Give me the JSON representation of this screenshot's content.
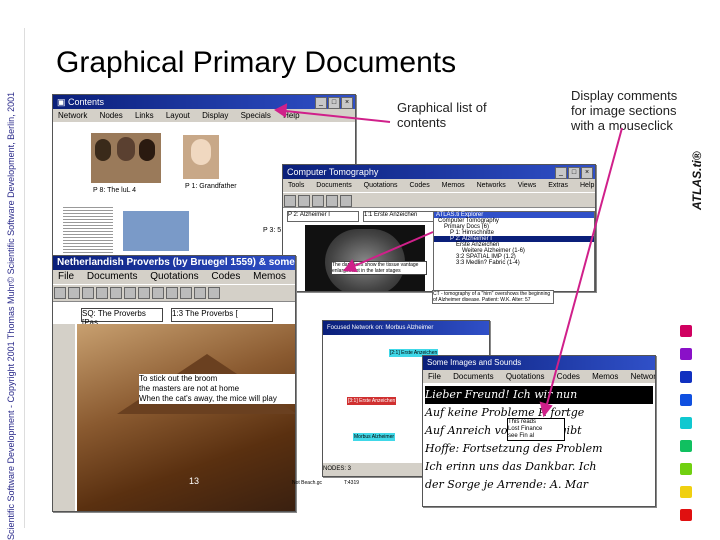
{
  "copyright_sidebar": "Scientific Software Development - Copyright 2001 Thomas Muhr© Scientific Software Development, Berlin, 2001",
  "brand": "ATLAS.ti®",
  "page_title": "Graphical Primary Documents",
  "callouts": {
    "list": "Graphical list of contents",
    "comments_l1": "Display comments",
    "comments_l2": "for image sections",
    "comments_l3": "with a mouseclick"
  },
  "contents_window": {
    "title": "Contents",
    "menu": [
      "Network",
      "Nodes",
      "Links",
      "Layout",
      "Display",
      "Specials",
      "Help"
    ],
    "thumb1_label": "P 8: The luL 4",
    "thumb2_label": "P 1: Grandfather",
    "thumb3_label": "P 3: 5"
  },
  "tomo_window": {
    "title": "Computer Tomography",
    "menu": [
      "Tools",
      "Documents",
      "Quotations",
      "Codes",
      "Memos",
      "Networks",
      "Views",
      "Extras",
      "Help"
    ],
    "field1": "P 2: Alzheimer I",
    "field2": "1:1 Erste Anzeichen",
    "note": "The dark lines show the tissue vantage enlargement in the later stages",
    "explorer_title": "ATLAS.ti Explorer",
    "tree": [
      "Computer Tomography",
      "Primary Docs (6)",
      "P 1: Hirnschnitte",
      "P 2: Alzheimer I",
      "Erste Anzeichen",
      "Weitere Alzheimer (1-6)",
      "3:2 SPATIAL IMP (1.2)",
      "3:3 Medlin? Fabric (1-4)"
    ],
    "comment": "CT - tomography of a \"hirn\" overshows the beginning of Alzheimer disease. Patient: W.K. Alter: 57"
  },
  "bruegel_window": {
    "title": "Netherlandish Proverbs (by Bruegel 1559) & some...",
    "menu": [
      "File",
      "Documents",
      "Quotations",
      "Codes",
      "Memos"
    ],
    "field1": "SQ: The Proverbs [Pas",
    "field2": "1:3 The Proverbs [",
    "caption1": "To stick out the broom",
    "caption2": "the masters are not at home",
    "caption3": "When the cat's away, the mice will play",
    "status": "13"
  },
  "network_window": {
    "title": "Focused Network on: Morbus Alzheimer",
    "node1": "[2:1] Erste Anzeichen",
    "node2": "[3:1] Erste Anzeichen",
    "node3": "Morbus Alzheimer",
    "status1": "NODES: 3",
    "status2": "Not Beach.gc",
    "status3": "T:4319"
  },
  "ger_window": {
    "title": "Some Images and Sounds",
    "menu": [
      "File",
      "Documents",
      "Quotations",
      "Codes",
      "Memos",
      "Networks"
    ],
    "popup1": "This reads",
    "popup2": "Lost Finance",
    "popup3": "see Fin al",
    "lines": [
      "Lieber Freund! Ich wir nun",
      "Auf keine Probleme P. fortge",
      "Auf Anreich vor die mir gibt",
      "Hoffe: Fortsetzung des Problem",
      "Ich erinn uns das Dankbar. Ich",
      "der Sorge je Arrende: A. Mar"
    ]
  },
  "colors": {
    "title_bar": "#0a1f7a",
    "arrow_magenta": "#d0208a",
    "nav_squares": [
      "#d00060",
      "#8a10c8",
      "#1030c0",
      "#1050e0",
      "#10c8d0",
      "#10c060",
      "#70d010",
      "#f0d010",
      "#f07010",
      "#e01010"
    ]
  },
  "icons": {
    "contents_icon": "contents-icon",
    "arrow": "arrow-icon"
  }
}
